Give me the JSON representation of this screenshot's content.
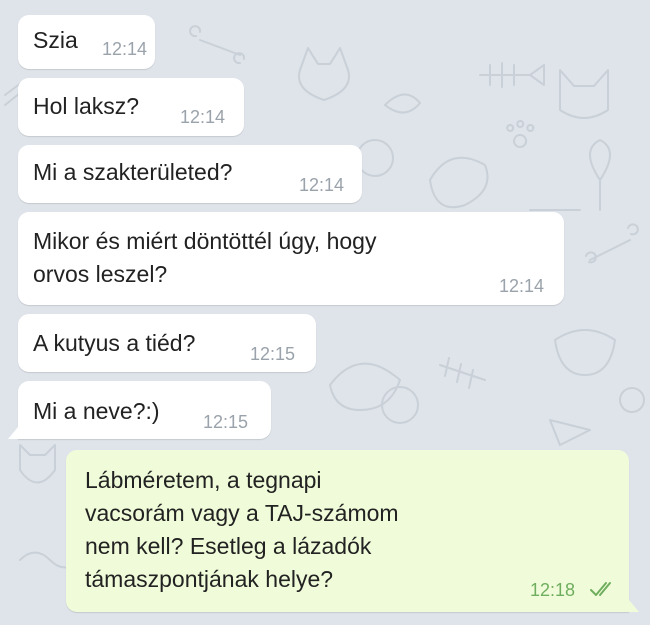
{
  "conversation": {
    "incoming": [
      {
        "text": "Szia",
        "time": "12:14"
      },
      {
        "text": "Hol laksz?",
        "time": "12:14"
      },
      {
        "text": "Mi a szakterületed?",
        "time": "12:14"
      },
      {
        "text": [
          "Mikor és miért döntöttél úgy, hogy",
          "orvos leszel?"
        ],
        "time": "12:14"
      },
      {
        "text": "A kutyus a tiéd?",
        "time": "12:15"
      },
      {
        "text": "Mi a neve?:)",
        "time": "12:15"
      }
    ],
    "outgoing": {
      "text": [
        "Lábméretem, a tegnapi",
        "vacsorám vagy a TAJ-számom",
        "nem kell? Esetleg a lázadók",
        "támaszpontjának helye?"
      ],
      "time": "12:18",
      "status_icon": "double-check-icon"
    }
  },
  "colors": {
    "chat_background": "#dfe4ea",
    "incoming_bubble": "#ffffff",
    "outgoing_bubble": "#f0fcd9",
    "incoming_time": "#9aa3ab",
    "outgoing_time": "#6fae5e"
  }
}
